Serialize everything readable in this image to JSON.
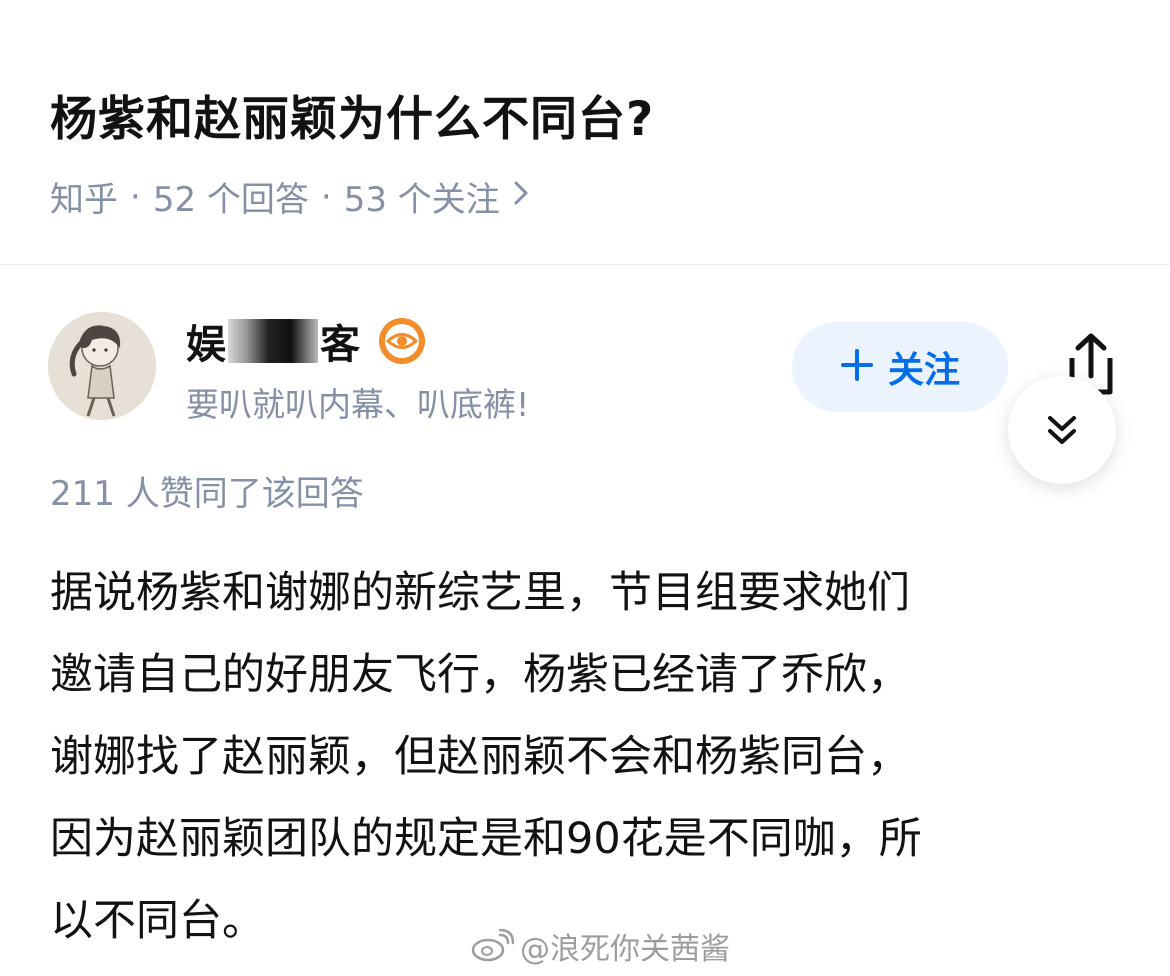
{
  "question": {
    "title": "杨紫和赵丽颖为什么不同台?",
    "source": "知乎",
    "separator": "·",
    "answers_count": "52 个回答",
    "followers_count": "53 个关注",
    "more_icon": "chevron-right-icon"
  },
  "author": {
    "name_start": "娱",
    "name_end": "客",
    "bio": "要叭就叭内幕、叭底裤!",
    "badge_icon": "eye-badge-icon",
    "follow_label": "关注",
    "follow_icon": "plus-icon"
  },
  "actions": {
    "share_icon": "share-icon",
    "collapse_icon": "double-chevron-down-icon"
  },
  "answer": {
    "votes_text": "211 人赞同了该回答",
    "lines": [
      "据说杨紫和谢娜的新综艺里，节目组要求她们",
      "邀请自己的好朋友飞行，杨紫已经请了乔欣，",
      "谢娜找了赵丽颖，但赵丽颖不会和杨紫同台，",
      "因为赵丽颖团队的规定是和90花是不同咖，所",
      "以不同台。"
    ]
  },
  "watermark": {
    "text": "@浪死你关茜酱",
    "icon": "weibo-icon"
  },
  "colors": {
    "title": "#121212",
    "meta": "#8590a6",
    "brand_blue": "#056de8",
    "follow_bg": "#ebf3ff",
    "badge_orange": "#f38d2c"
  }
}
